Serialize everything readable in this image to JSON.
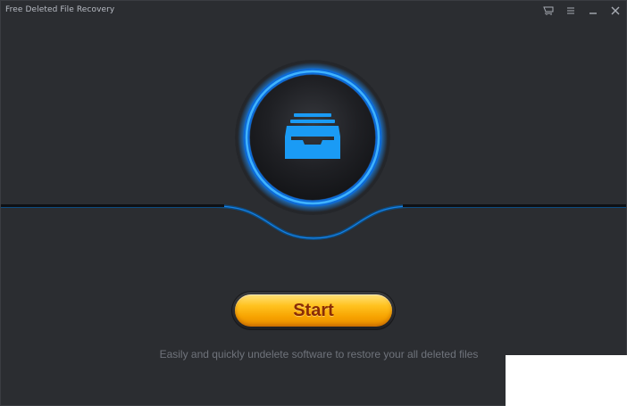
{
  "window": {
    "title": "Free Deleted File Recovery"
  },
  "titlebar": {
    "buttons": [
      {
        "name": "cart-icon",
        "glyph": ""
      },
      {
        "name": "menu-icon",
        "glyph": ""
      },
      {
        "name": "minimize-icon",
        "glyph": "–"
      },
      {
        "name": "close-icon",
        "glyph": "✕"
      }
    ]
  },
  "main": {
    "hero_icon": "inbox-tray-icon",
    "start_label": "Start",
    "tagline": "Easily and quickly undelete software to restore your all deleted files"
  },
  "colors": {
    "background": "#2b2d31",
    "ring_blue": "#1a8fff",
    "button_orange": "#ffc21f",
    "button_text": "#8a2c05"
  }
}
